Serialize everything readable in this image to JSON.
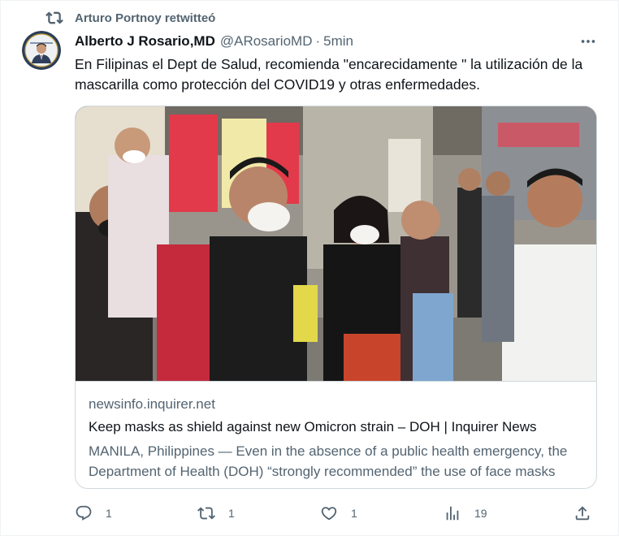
{
  "context": {
    "text": "Arturo Portnoy retwitteó",
    "icon": "retweet-icon"
  },
  "author": {
    "name": "Alberto J Rosario,MD",
    "handle": "@ARosarioMD",
    "separator": "·",
    "time": "5min",
    "avatar_icon": "profile-photo"
  },
  "tweet": {
    "text": "En Filipinas el Dept de Salud, recomienda \"encarecidamente \" la utilización de la mascarilla como protección del COVID19 y otras enfermedades."
  },
  "card": {
    "image_alt": "crowd-wearing-masks-photo",
    "domain": "newsinfo.inquirer.net",
    "title": "Keep masks as shield against new Omicron strain – DOH | Inquirer News",
    "description": "MANILA, Philippines — Even in the absence of a public health emergency, the Department of Health (DOH) “strongly recommended” the use of face masks"
  },
  "actions": {
    "replies": "1",
    "retweets": "1",
    "likes": "1",
    "views": "19"
  },
  "colors": {
    "text_primary": "#0f1419",
    "text_secondary": "#536471",
    "border": "#cfd9de",
    "background": "#ffffff"
  }
}
